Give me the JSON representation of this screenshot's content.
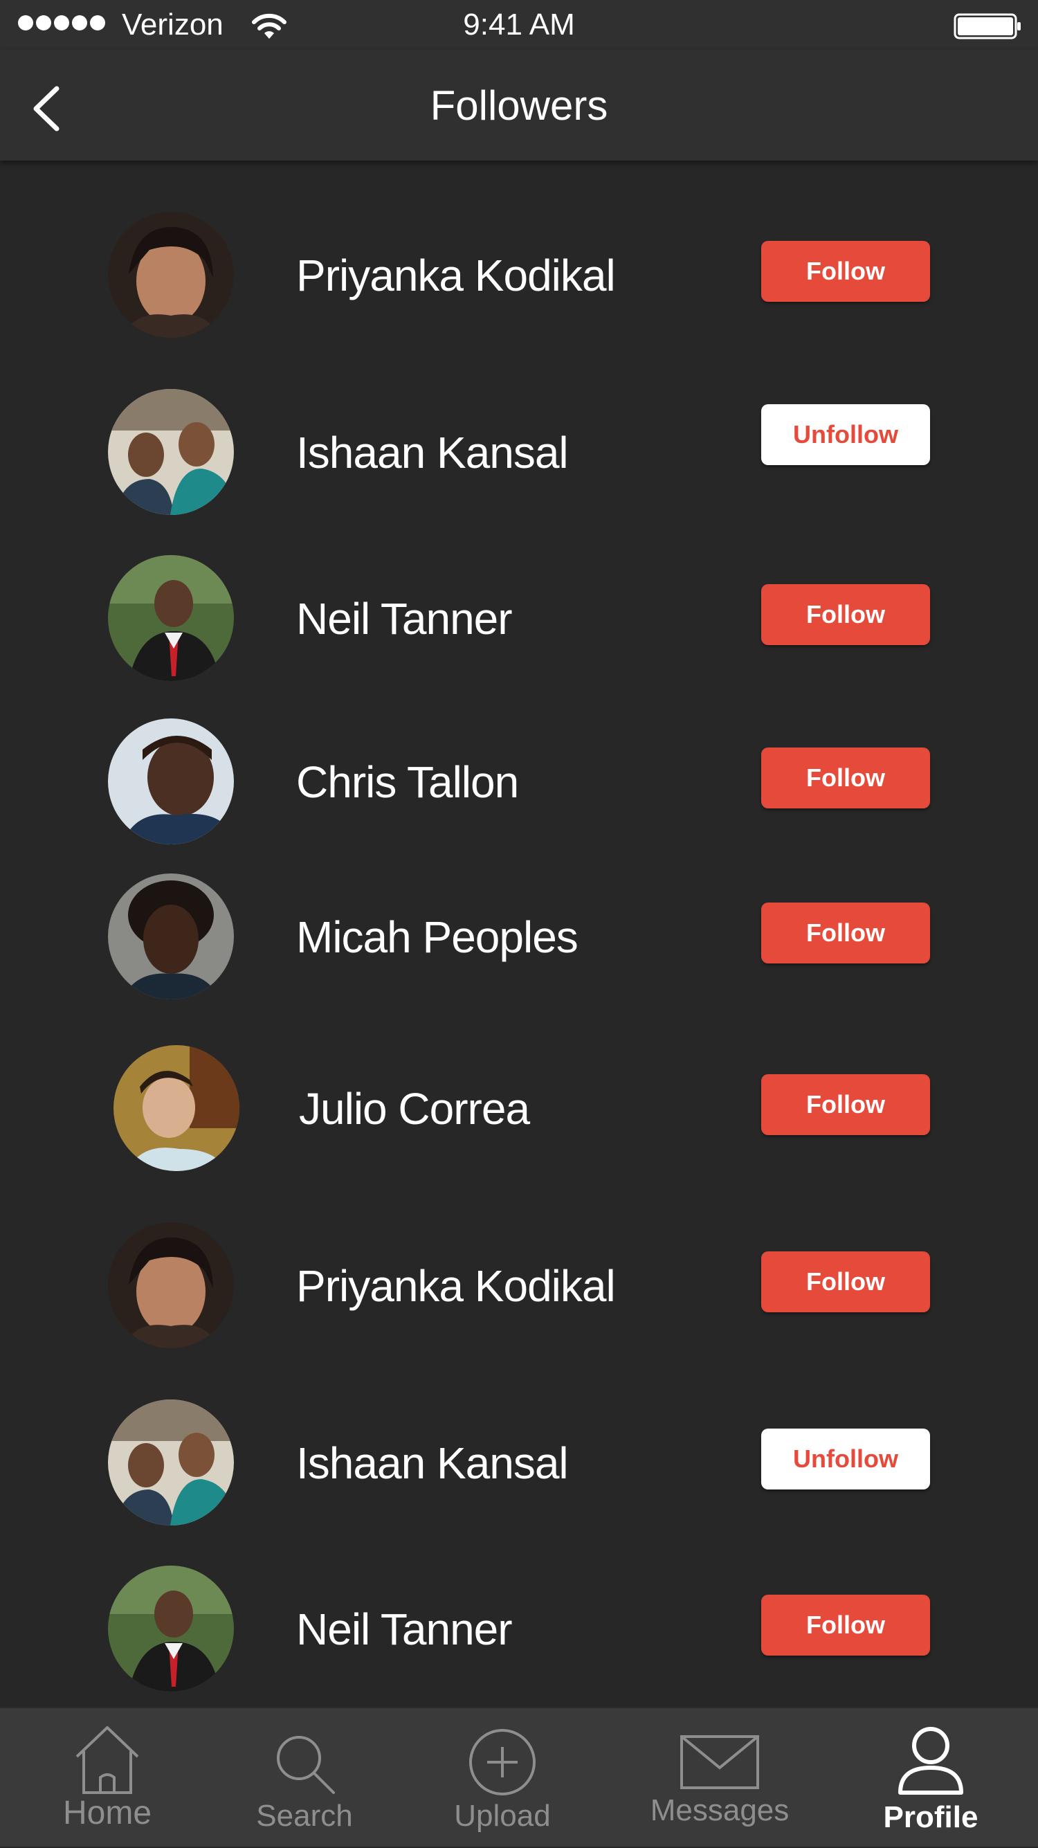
{
  "status_bar": {
    "carrier": "Verizon",
    "time": "9:41 AM",
    "icons": [
      "signal-dots-icon",
      "wifi-icon",
      "battery-icon"
    ]
  },
  "nav": {
    "title": "Followers",
    "back_icon": "chevron-left-icon"
  },
  "followers": [
    {
      "name": "Priyanka Kodikal",
      "action": "Follow"
    },
    {
      "name": "Ishaan Kansal",
      "action": "Unfollow"
    },
    {
      "name": "Neil Tanner",
      "action": "Follow"
    },
    {
      "name": "Chris Tallon",
      "action": "Follow"
    },
    {
      "name": "Micah Peoples",
      "action": "Follow"
    },
    {
      "name": "Julio Correa",
      "action": "Follow"
    },
    {
      "name": "Priyanka Kodikal",
      "action": "Follow"
    },
    {
      "name": "Ishaan Kansal",
      "action": "Unfollow"
    },
    {
      "name": "Neil Tanner",
      "action": "Follow"
    }
  ],
  "tab_bar": {
    "tabs": [
      {
        "label": "Home",
        "icon": "home-icon"
      },
      {
        "label": "Search",
        "icon": "search-icon"
      },
      {
        "label": "Upload",
        "icon": "upload-plus-icon"
      },
      {
        "label": "Messages",
        "icon": "envelope-icon"
      },
      {
        "label": "Profile",
        "icon": "person-icon"
      }
    ],
    "active": "Profile"
  },
  "colors": {
    "background": "#272727",
    "bar": "#303030",
    "tab_bar": "#3a3a3a",
    "accent": "#e54a3a",
    "text": "#ffffff",
    "inactive_tab": "#8e8e8e"
  }
}
